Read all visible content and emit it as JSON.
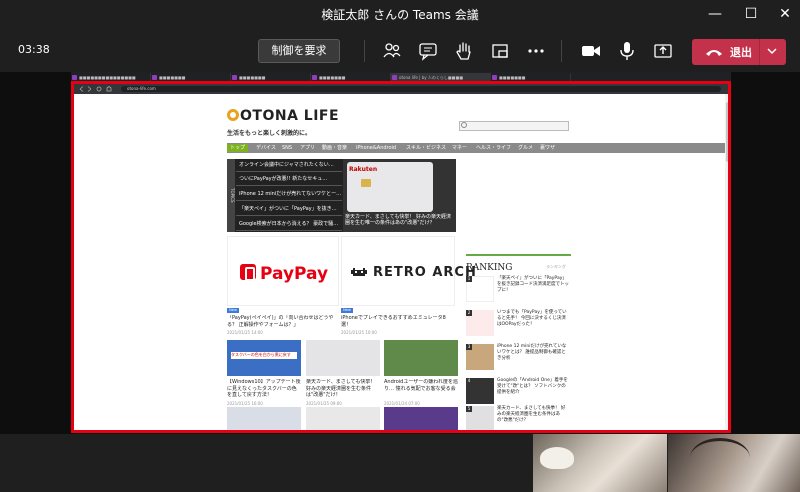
{
  "window": {
    "title": "検証太郎 さんの Teams 会議",
    "minimize": "—",
    "maximize": "☐",
    "close": "✕"
  },
  "toolbar": {
    "timer": "03:38",
    "request_control": "制御を要求",
    "leave_label": "退出",
    "icons": [
      "people-icon",
      "chat-icon",
      "raise-hand-icon",
      "layout-icon",
      "more-icon",
      "camera-icon",
      "mic-icon",
      "share-icon",
      "hang-up-icon"
    ]
  },
  "browser": {
    "tabs": [
      "■■■■■■■■■■■■■■■",
      "■■■■■■■",
      "■■■■■■■",
      "■■■■■■■",
      "otona life | by 人のくらし■■■■",
      "■■■■■■■"
    ],
    "url": "otona-life.com"
  },
  "site": {
    "logo": "OTONA LIFE",
    "tagline": "生活をもっと楽しく刺激的に。",
    "nav": [
      "トップ",
      "デバイス",
      "SNS",
      "アプリ",
      "動画・音楽",
      "iPhone&Android",
      "スキル・ビジネス",
      "マネー",
      "ヘルス・ライフ",
      "グルメ",
      "裏ワザ"
    ],
    "topics_label": "TOPICS",
    "topics": [
      "オンライン会議中にジャマされたくない…",
      "ついにPayPayが改悪!! 新たなセキュ…",
      "iPhone 12 miniだけが売れてないワケとー…",
      "「楽天ペイ」がついに「PayPay」を抜き…",
      "Google検索が日本から消える？ 豪政で騒…"
    ],
    "feature_brand": "Rakuten",
    "feature_caption": "楽天カード、まさしても快挙！ 好みの楽天経済圏を生む唯一の条件はあの\"改悪\"だけ？",
    "articles": [
      {
        "badge": "New",
        "caption": "「PayPay(ペイペイ)」の「向い合わせはどうやる？ 正解操作やフォームは？」",
        "date": "2021/01/25 14:00"
      },
      {
        "badge": "New",
        "caption": "iPhoneでプレイできるおすすめエミュレータ8選！",
        "date": "2021/01/25 10:00"
      },
      {
        "badge": "",
        "caption": "【Windows10】アップデート後に見えなくったタスクバーの色を直して戻す方法！",
        "date": "2021/01/25 16:00"
      },
      {
        "badge": "",
        "caption": "楽天カード、まさしても快挙！ 好みの楽天経済圏を生む条件は\"改悪\"だけ！",
        "date": "2021/01/25 09:00"
      },
      {
        "badge": "",
        "caption": "Androidユーザーの嫌われ度を巡り… 憧れる気配でお客な受る会",
        "date": "2021/01/24 07:00"
      }
    ],
    "thumb_title": "タスクバーの色を白から黒に戻す",
    "pp_word": "PayPay",
    "retro_word": "RETRO ARCH",
    "ranking_title": "RANKING",
    "ranking_sub": "ランキング",
    "ranking": [
      {
        "num": "1",
        "text": "「楽天ペイ」がついに「PayPay」を抜き記録コード決済満足度でトップに！"
      },
      {
        "num": "2",
        "text": "いつまでも「PayPay」を使っていると先手！ 今回に決するくじ決済はOOPayだった！"
      },
      {
        "num": "3",
        "text": "iPhone 12 miniだけが売れていないワケとは？ 誰提品制御も確認とき分析"
      },
      {
        "num": "4",
        "text": "Googleの「Android One」着手を受けて\"改\"とは？ ソフトバンクの提供を紹介"
      },
      {
        "num": "5",
        "text": "楽天カード、まさしても快挙！ 好みの楽天経済圏を生む条件はあの\"改悪\"だけ？"
      }
    ]
  },
  "colors": {
    "leave": "#c4314b",
    "frame": "#e60012",
    "nav_active": "#7fb125",
    "paypay": "#e60012"
  }
}
